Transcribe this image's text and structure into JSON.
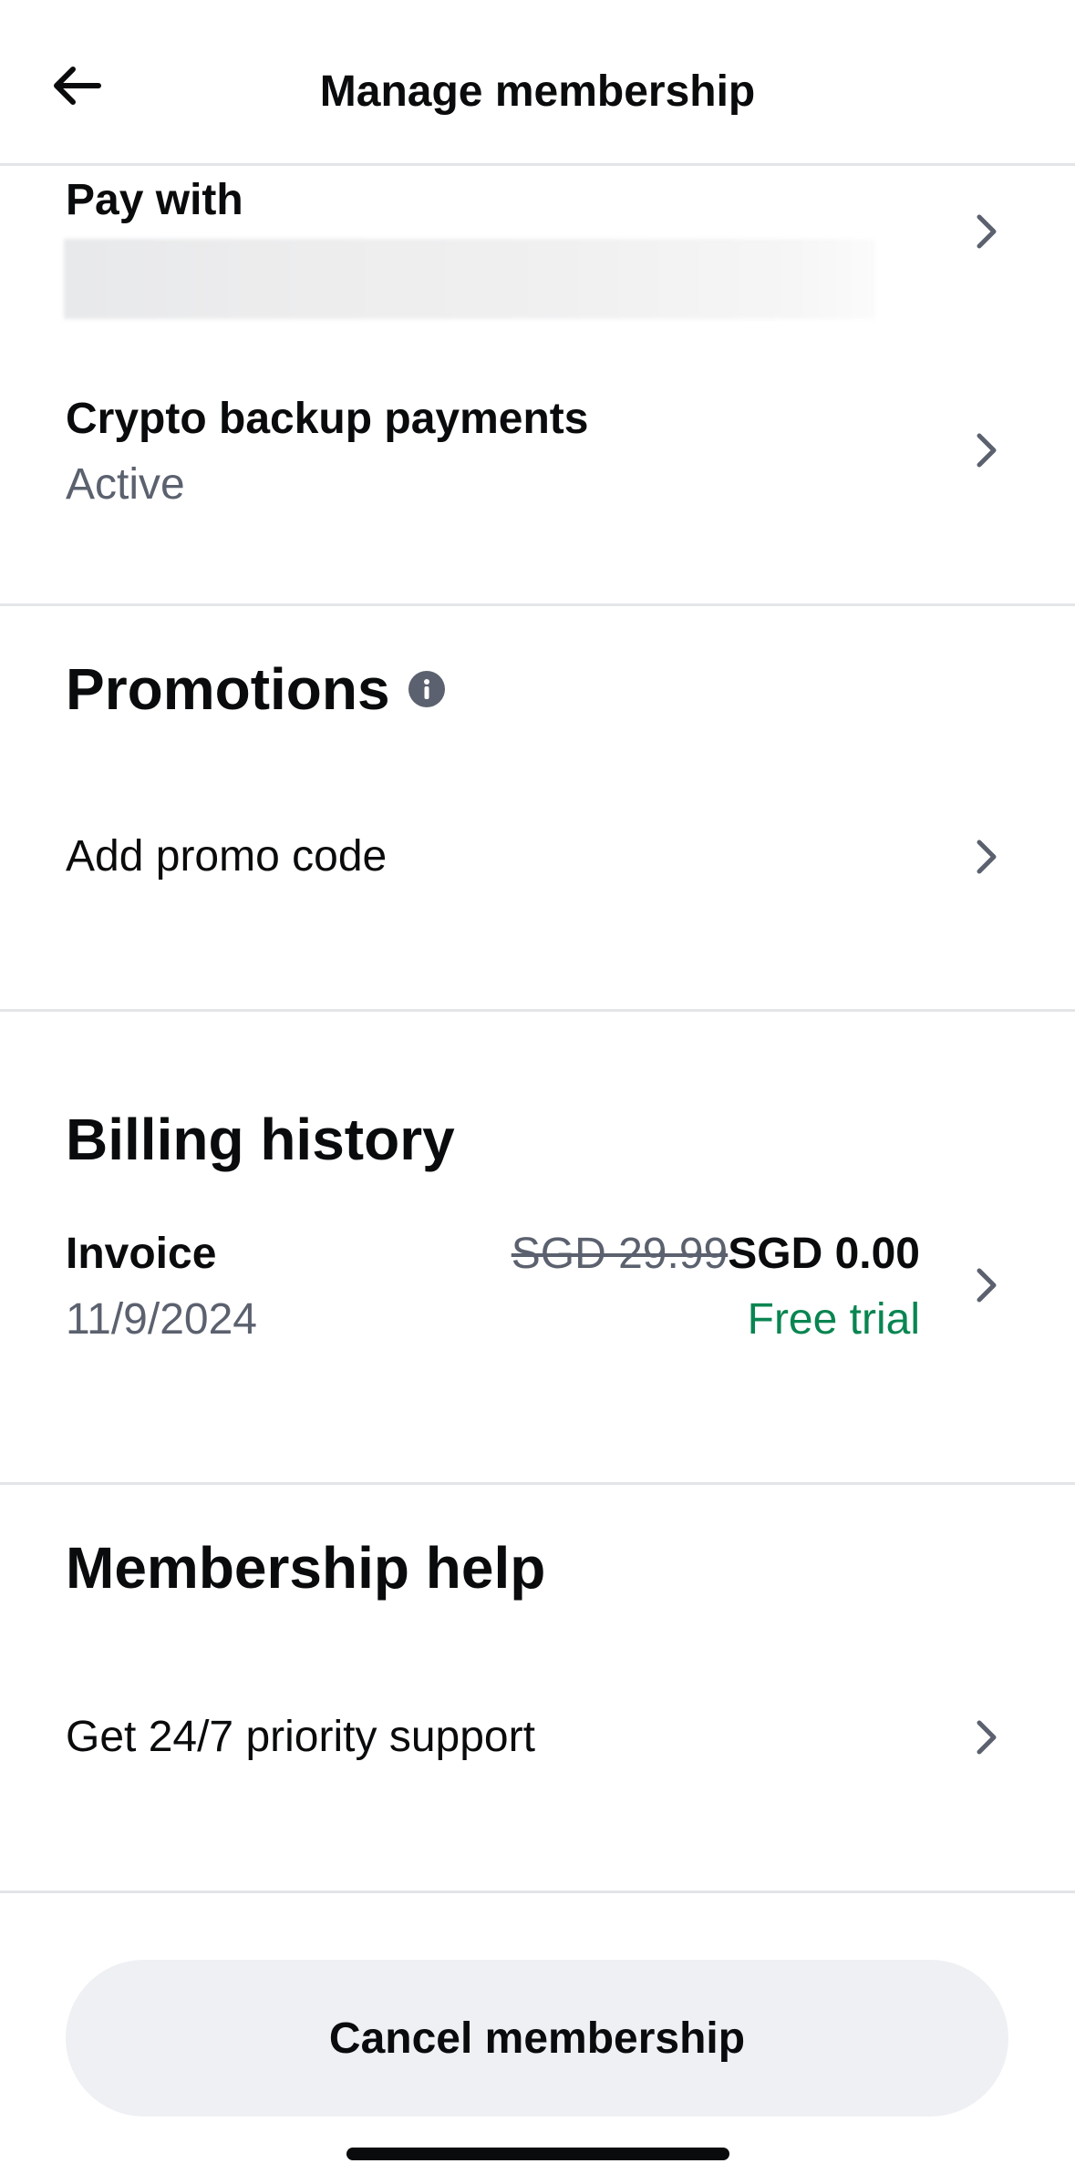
{
  "header": {
    "title": "Manage membership"
  },
  "payment": {
    "pay_with_label": "Pay with",
    "crypto_backup_label": "Crypto backup payments",
    "crypto_backup_status": "Active"
  },
  "promotions": {
    "title": "Promotions",
    "add_promo_label": "Add promo code"
  },
  "billing": {
    "title": "Billing history",
    "invoice": {
      "label": "Invoice",
      "date": "11/9/2024",
      "original_price": "SGD 29.99",
      "price": "SGD 0.00",
      "note": "Free trial"
    }
  },
  "help": {
    "title": "Membership help",
    "support_label": "Get 24/7 priority support"
  },
  "footer": {
    "cancel_label": "Cancel membership"
  },
  "icons": {
    "back": "arrow-left-icon",
    "chevron": "chevron-right-icon",
    "info": "info-icon"
  },
  "colors": {
    "text": "#0a0b0d",
    "muted": "#5b616e",
    "positive": "#098551",
    "divider": "#e3e5e8",
    "button_bg": "#eef0f3"
  }
}
